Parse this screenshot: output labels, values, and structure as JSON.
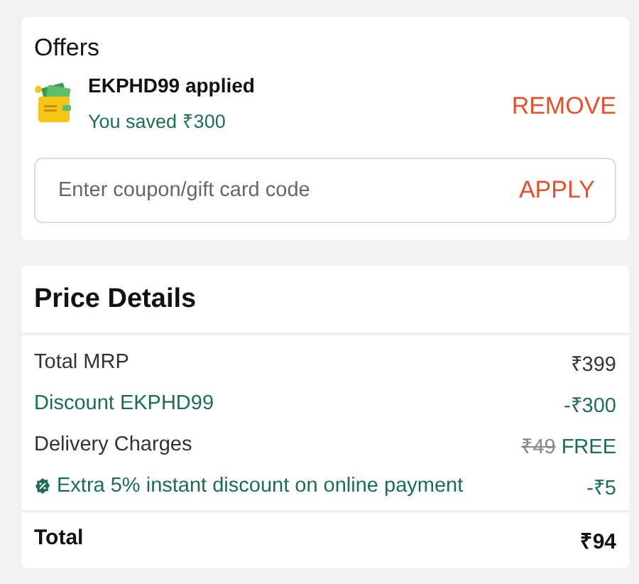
{
  "offers": {
    "title": "Offers",
    "coupon": {
      "code_text": "EKPHD99 applied",
      "saved_text": "You saved ₹300",
      "action": "REMOVE"
    },
    "coupon_field": {
      "placeholder": "Enter coupon/gift card code",
      "action": "APPLY"
    }
  },
  "price_details": {
    "title": "Price Details",
    "rows": [
      {
        "kind": "plain",
        "label": "Total MRP",
        "value": "₹399"
      },
      {
        "kind": "saving",
        "label": "Discount EKPHD99",
        "value": "-₹300"
      },
      {
        "kind": "delivery",
        "label": "Delivery Charges",
        "original": "₹49",
        "value": "FREE"
      },
      {
        "kind": "offer",
        "label": "Extra 5% instant discount on online payment",
        "value": "-₹5"
      }
    ],
    "total": {
      "label": "Total",
      "value": "₹94"
    }
  }
}
